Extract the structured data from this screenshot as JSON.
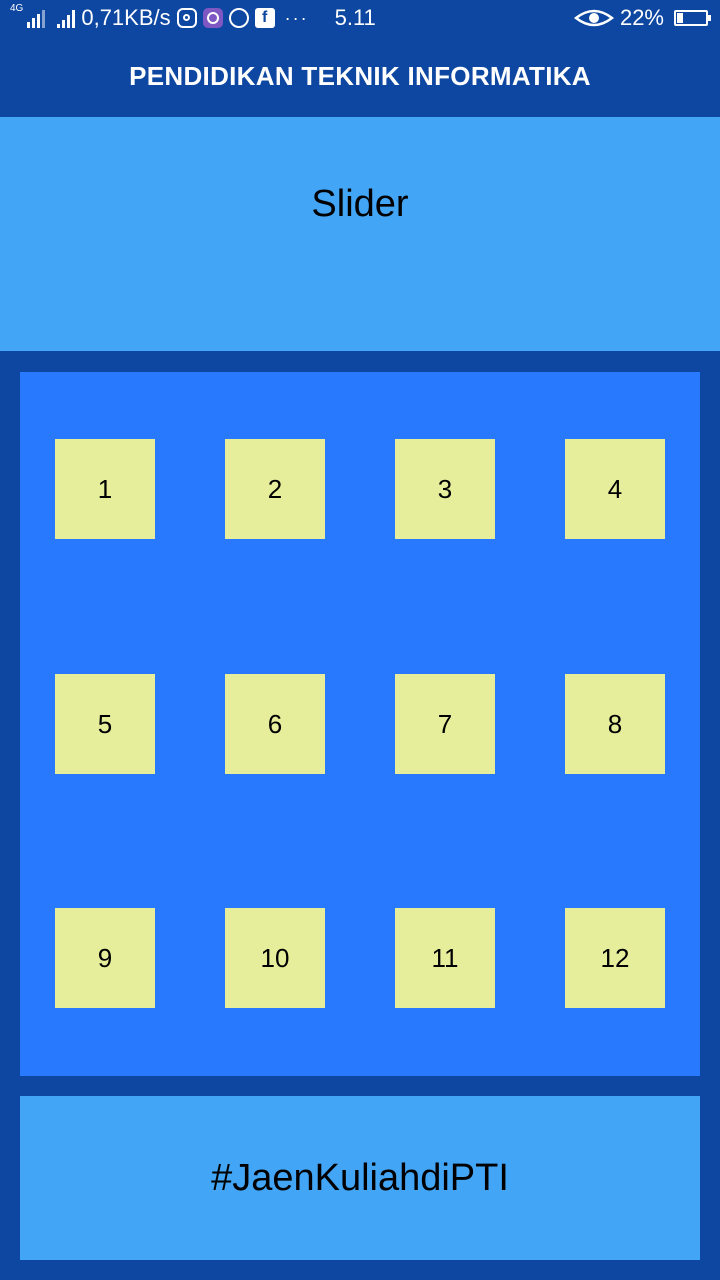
{
  "status_bar": {
    "network_type": "4G",
    "speed": "0,71KB/s",
    "more": "···",
    "time": "5.11",
    "battery_percent_label": "22%",
    "battery_level": 0.22,
    "icons": [
      "signal-icon",
      "signal-icon",
      "instagram-icon",
      "browser-app-icon",
      "whatsapp-icon",
      "facebook-icon",
      "eye-comfort-icon",
      "battery-icon"
    ]
  },
  "app_bar": {
    "title": "PENDIDIKAN TEKNIK INFORMATIKA"
  },
  "slider": {
    "label": "Slider"
  },
  "menu": {
    "items": [
      "1",
      "2",
      "3",
      "4",
      "5",
      "6",
      "7",
      "8",
      "9",
      "10",
      "11",
      "12"
    ]
  },
  "footer": {
    "text": "#JaenKuliahdiPTI"
  },
  "colors": {
    "app_bar": "#0d47a1",
    "slider_bg": "#42a5f5",
    "grid_bg": "#2979ff",
    "tile_bg": "#e6ee9c"
  }
}
